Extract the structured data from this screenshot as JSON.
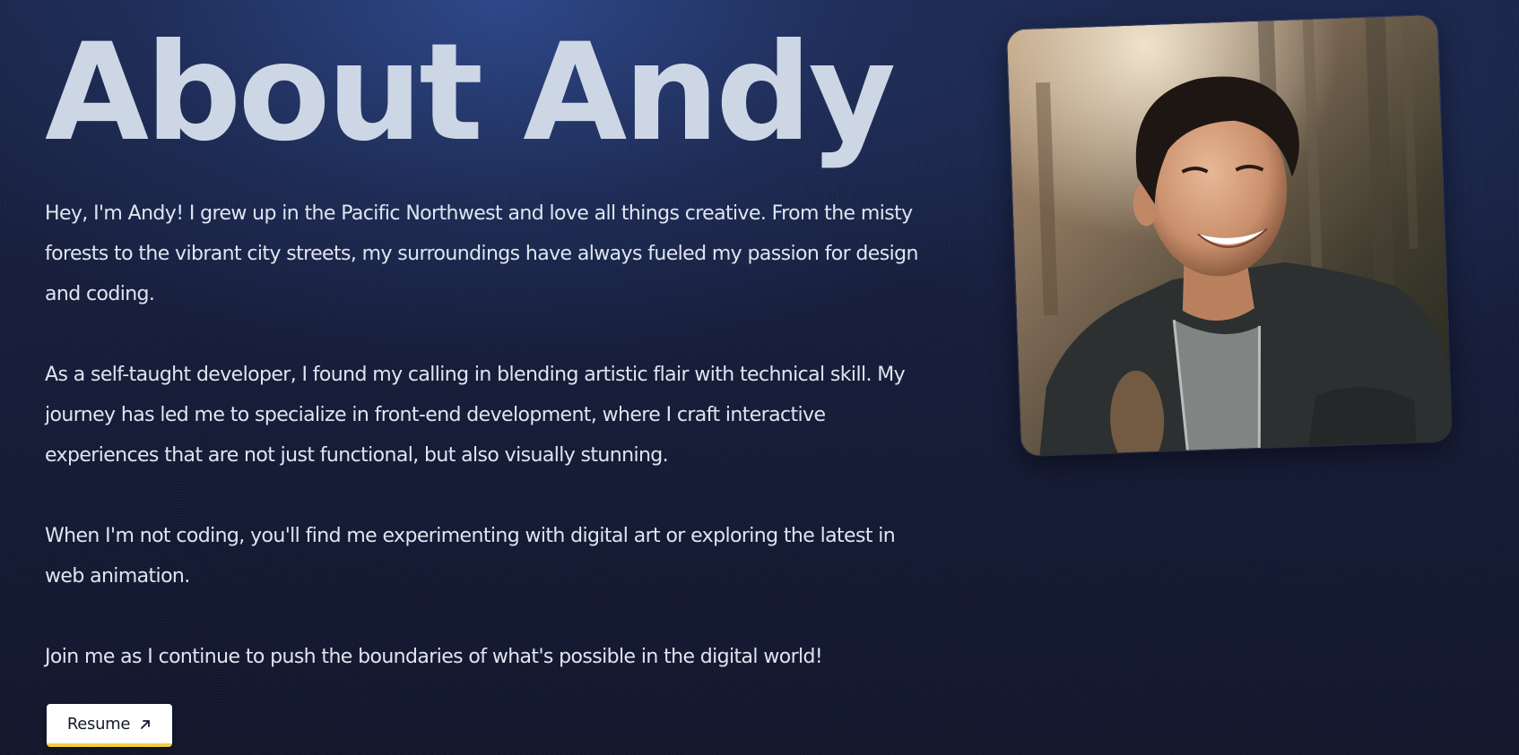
{
  "page": {
    "title": "About Andy"
  },
  "bio": {
    "paragraphs": [
      "Hey, I'm Andy! I grew up in the Pacific Northwest and love all things creative. From the misty forests to the vibrant city streets, my surroundings have always fueled my passion for design and coding.",
      "As a self-taught developer, I found my calling in blending artistic flair with technical skill. My journey has led me to specialize in front-end development, where I craft interactive experiences that are not just functional, but also visually stunning.",
      "When I'm not coding, you'll find me experimenting with digital art or exploring the latest in web animation.",
      "Join me as I continue to push the boundaries of what's possible in the digital world!"
    ]
  },
  "resume": {
    "label": "Resume",
    "icon": "arrow-up-right-icon"
  },
  "photo": {
    "subject": "portrait-photo"
  },
  "colors": {
    "background": "#161d3a",
    "title": "#cdd6e4",
    "text": "#dfe5f0",
    "button_bg": "#ffffff",
    "button_accent": "#f3cf3a"
  }
}
